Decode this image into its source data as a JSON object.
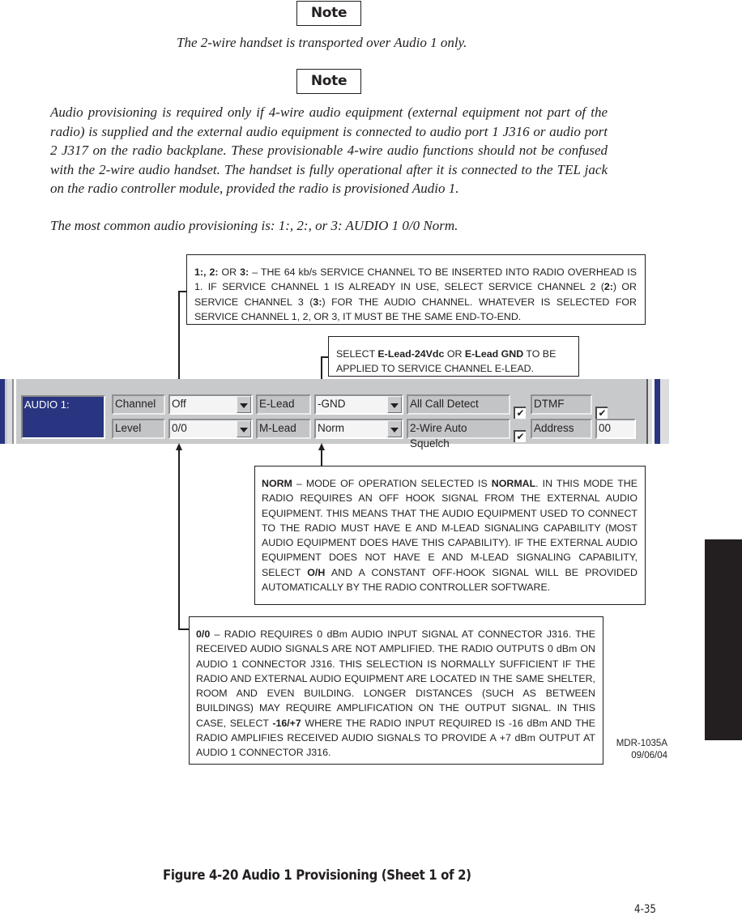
{
  "notes": [
    {
      "label": "Note",
      "text": "The 2-wire handset is transported over Audio 1 only."
    },
    {
      "label": "Note",
      "paragraphs": [
        "Audio provisioning is required only if 4-wire audio equipment (external equipment not part of the radio) is supplied and the external audio equipment is connected to audio port 1 J316 or audio port 2 J317 on the radio backplane. These provisionable 4-wire audio functions should not be confused with the 2-wire audio handset. The handset is fully operational after it is connected to the TEL jack on the radio controller module, provided the radio is provisioned Audio 1.",
        "The most common audio provisioning is: 1:, 2:, or 3: AUDIO 1 0/0 Norm."
      ]
    }
  ],
  "callouts": {
    "channel": {
      "b1": "1:, 2:",
      "t1": " OR ",
      "b2": "3:",
      "t2": " – THE 64 kb/s SERVICE CHANNEL TO BE INSERTED INTO RADIO OVERHEAD IS 1. IF SERVICE CHANNEL 1 IS ALREADY IN USE, SELECT SERVICE CHANNEL 2 (",
      "b3": "2:",
      "t3": ") OR SERVICE CHANNEL 3 (",
      "b4": "3:",
      "t4": ") FOR THE AUDIO CHANNEL. WHATEVER IS SELECTED FOR SERVICE CHANNEL 1, 2, OR 3, IT MUST BE THE SAME END-TO-END."
    },
    "elead": {
      "t1": "SELECT ",
      "b1": "E-Lead-24Vdc",
      "t2": " OR ",
      "b2": "E-Lead GND",
      "t3": " TO BE APPLIED TO SERVICE CHANNEL E-LEAD."
    },
    "mlead": {
      "b1": "NORM",
      "t1": " – MODE OF OPERATION SELECTED IS ",
      "b2": "NORMAL",
      "t2": ". IN THIS MODE THE RADIO REQUIRES AN OFF HOOK SIGNAL FROM THE EXTERNAL AUDIO EQUIPMENT. THIS MEANS THAT THE AUDIO EQUIPMENT USED TO CONNECT TO THE RADIO MUST HAVE E AND M-LEAD SIGNALING CAPABILITY (MOST AUDIO EQUIPMENT DOES HAVE THIS CAPABILITY). IF THE EXTERNAL AUDIO EQUIPMENT DOES NOT HAVE E AND M-LEAD SIGNALING CAPABILITY, SELECT ",
      "b3": "O/H",
      "t3": " AND A CONSTANT OFF-HOOK SIGNAL WILL BE PROVIDED AUTOMATICALLY BY THE RADIO CONTROLLER SOFTWARE."
    },
    "level": {
      "b1": "0/0",
      "t1": " – RADIO REQUIRES 0 dBm AUDIO INPUT SIGNAL AT CONNECTOR J316. THE RECEIVED AUDIO SIGNALS ARE NOT AMPLIFIED. THE RADIO OUTPUTS 0 dBm ON AUDIO 1 CONNECTOR J316. THIS SELECTION IS NORMALLY SUFFICIENT IF THE RADIO AND EXTERNAL AUDIO EQUIPMENT ARE LOCATED IN THE SAME SHELTER, ROOM AND EVEN BUILDING. LONGER DISTANCES (SUCH AS BETWEEN BUILDINGS) MAY REQUIRE AMPLIFICATION ON THE OUTPUT SIGNAL. IN THIS CASE, SELECT ",
      "b2": "-16/+7",
      "t2": " WHERE THE RADIO INPUT REQUIRED IS -16 dBm AND THE RADIO AMPLIFIES RECEIVED AUDIO SIGNALS TO PROVIDE A +7 dBm OUTPUT AT AUDIO 1 CONNECTOR J316."
    }
  },
  "panel": {
    "title": "AUDIO 1:",
    "channel": {
      "label": "Channel",
      "value": "Off"
    },
    "level": {
      "label": "Level",
      "value": "0/0"
    },
    "elead": {
      "label": "E-Lead",
      "value": "-GND"
    },
    "mlead": {
      "label": "M-Lead",
      "value": "Norm"
    },
    "all_call_detect": {
      "label": "All Call Detect",
      "checked": true,
      "mark": "✔"
    },
    "auto_squelch": {
      "label": "2-Wire Auto Squelch",
      "checked": true,
      "mark": "✔"
    },
    "dtmf": {
      "label": "DTMF",
      "checked": true,
      "mark": "✔"
    },
    "address": {
      "label": "Address",
      "value": "00"
    }
  },
  "drawing_id": "MDR-1035A",
  "drawing_date": "09/06/04",
  "figure_caption": "Figure 4-20  Audio 1 Provisioning (Sheet 1 of 2)",
  "page_number": "4-35",
  "colors": {
    "panel_title_bg": "#293581",
    "panel_bg": "#c8c9cb",
    "ink": "#231f20"
  }
}
